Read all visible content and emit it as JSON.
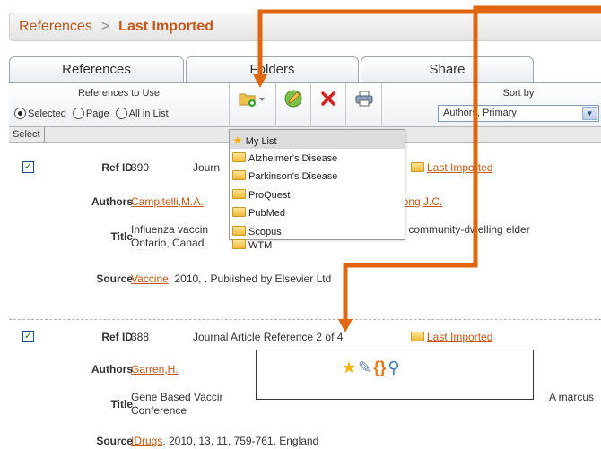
{
  "breadcrumb": {
    "root": "References",
    "separator": ">",
    "current": "Last Imported"
  },
  "tabs": [
    {
      "label": "References"
    },
    {
      "label": "Folders"
    },
    {
      "label": "Share"
    }
  ],
  "toolbar": {
    "references_to_use_label": "References to Use",
    "radio_options": [
      {
        "label": "Selected",
        "selected": true
      },
      {
        "label": "Page",
        "selected": false
      },
      {
        "label": "All in List",
        "selected": false
      }
    ],
    "sort_by_label": "Sort by",
    "sort_value": "Authors, Primary",
    "buttons": [
      {
        "icon": "add-to-folder-icon"
      },
      {
        "icon": "edit-icon"
      },
      {
        "icon": "delete-icon"
      },
      {
        "icon": "print-icon"
      }
    ]
  },
  "select_column_header": "Select",
  "folder_menu": {
    "items": [
      "My List",
      "Alzheimer's Disease",
      "Parkinson's Disease",
      "ProQuest",
      "PubMed",
      "Scopus",
      "WTM"
    ]
  },
  "references": [
    {
      "checked": true,
      "ref_id_label": "Ref ID",
      "ref_id": "390",
      "type_text": "Journ",
      "folder": "Last Imported",
      "authors_label": "Authors",
      "author_first": "Campitelli,M.A.",
      "author_sep": ";",
      "author_last": "wong,J.C.",
      "title_label": "Title",
      "title_line1_a": "Influenza vaccin",
      "title_line1_b": "ty in community-dwelling elder",
      "title_line2": "Ontario, Canad",
      "source_label": "Source",
      "source_journal": "Vaccine",
      "source_rest": ", 2010, . Published by Elsevier Ltd"
    },
    {
      "checked": true,
      "ref_id_label": "Ref ID",
      "ref_id": "388",
      "type_text": "Journal Article Reference 2 of 4",
      "folder": "Last Imported",
      "authors_label": "Authors",
      "author_first": "Garren,H.",
      "title_label": "Title",
      "title_line1_a": "Gene Based Vaccir",
      "title_line1_b": "A marcus",
      "title_line2": "Conference",
      "source_label": "Source",
      "source_journal": "IDrugs",
      "source_rest": ", 2010, 13, 11, 759-761, England"
    }
  ],
  "icon_popup": {
    "icons": [
      "star-icon",
      "pencil-icon",
      "braces-icon",
      "magnifier-icon"
    ]
  },
  "colors": {
    "accent": "#c4581a",
    "arrow": "#e2650f",
    "tab_border": "#9fa7b0"
  }
}
